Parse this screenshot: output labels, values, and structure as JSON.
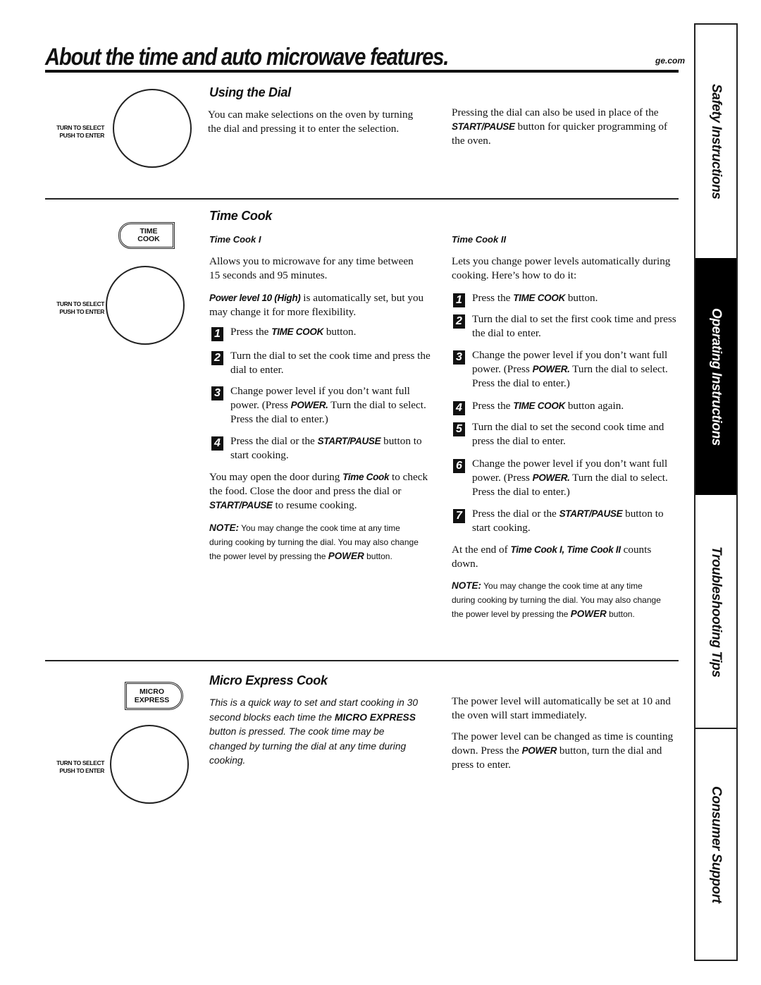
{
  "header": {
    "title": "About the time and auto microwave features.",
    "site": "ge.com"
  },
  "dial_label": {
    "line1": "TURN TO SELECT",
    "line2": "PUSH TO ENTER"
  },
  "using_dial": {
    "heading": "Using the Dial",
    "left_text": "You can make selections on the oven by turning the dial and pressing it to enter the selection.",
    "right_pre": "Pressing the dial can also be used in place of the ",
    "right_bold": "START/PAUSE",
    "right_post": " button for quicker programming of the oven."
  },
  "time_cook": {
    "heading": "Time Cook",
    "button_line1": "TIME",
    "button_line2": "COOK",
    "tc1": {
      "heading": "Time Cook I",
      "intro": "Allows you to microwave for any time between 15 seconds and 95 minutes.",
      "power_bold": "Power level 10 (High)",
      "power_rest": " is automatically set, but you may change it for more flexibility.",
      "steps": [
        {
          "num": "1",
          "pre": "Press the ",
          "bold": "TIME COOK",
          "post": " button."
        },
        {
          "num": "2",
          "pre": "Turn the dial to set the cook time and press the dial to enter.",
          "bold": "",
          "post": ""
        },
        {
          "num": "3",
          "pre": "Change power level if you don’t want full power. (Press ",
          "bold": "POWER.",
          "post": " Turn the dial to select. Press the dial to enter.)"
        },
        {
          "num": "4",
          "pre": "Press the dial or the ",
          "bold": "START/PAUSE",
          "post": " button to start cooking."
        }
      ],
      "door_pre": "You may open the door during ",
      "door_bold1": "Time Cook",
      "door_mid": " to check the food. Close the door and press the dial or ",
      "door_bold2": "START/PAUSE",
      "door_post": " to resume cooking.",
      "note_label": "NOTE:",
      "note_text": " You may change the cook time at any time during cooking by turning the dial. You may also change the power level by pressing the ",
      "note_bold": "POWER",
      "note_end": " button."
    },
    "tc2": {
      "heading": "Time Cook II",
      "intro": "Lets you change power levels automatically during cooking. Here’s how to do it:",
      "steps": [
        {
          "num": "1",
          "pre": "Press the ",
          "bold": "TIME COOK",
          "post": " button."
        },
        {
          "num": "2",
          "pre": "Turn the dial to set the first cook time and press the dial to enter.",
          "bold": "",
          "post": ""
        },
        {
          "num": "3",
          "pre": "Change the power level if you don’t want full power. (Press ",
          "bold": "POWER.",
          "post": " Turn the dial to select. Press the dial to enter.)"
        },
        {
          "num": "4",
          "pre": "Press the ",
          "bold": "TIME COOK",
          "post": " button again."
        },
        {
          "num": "5",
          "pre": "Turn the dial to set the second cook time and press the dial to enter.",
          "bold": "",
          "post": ""
        },
        {
          "num": "6",
          "pre": "Change the power level if you don’t want full power. (Press ",
          "bold": "POWER.",
          "post": " Turn the dial to select. Press the dial to enter.)"
        },
        {
          "num": "7",
          "pre": "Press the dial or the ",
          "bold": "START/PAUSE",
          "post": " button to start cooking."
        }
      ],
      "end_pre": "At the end of ",
      "end_bold": "Time Cook I, Time Cook II",
      "end_post": " counts down.",
      "note_label": "NOTE:",
      "note_text": " You may change the cook time at any time during cooking by turning the dial. You may also change the power level by pressing the ",
      "note_bold": "POWER",
      "note_end": " button."
    }
  },
  "micro_express": {
    "heading": "Micro Express Cook",
    "button_line1": "MICRO",
    "button_line2": "EXPRESS",
    "desc_pre": "This is a quick way to set and start cooking in 30 second blocks each time the ",
    "desc_bold": "MICRO EXPRESS",
    "desc_post": " button is pressed. The cook time may be changed by turning the dial at any time during cooking.",
    "right_p1": "The power level will automatically be set at 10 and the oven will start immediately.",
    "right_p2_pre": "The power level can be changed as time is counting down. Press the ",
    "right_p2_bold": "POWER",
    "right_p2_post": " button, turn the dial and press to enter."
  },
  "side_tabs": [
    {
      "label": "Safety Instructions",
      "active": false
    },
    {
      "label": "Operating Instructions",
      "active": true
    },
    {
      "label": "Troubleshooting Tips",
      "active": false
    },
    {
      "label": "Consumer Support",
      "active": false
    }
  ]
}
